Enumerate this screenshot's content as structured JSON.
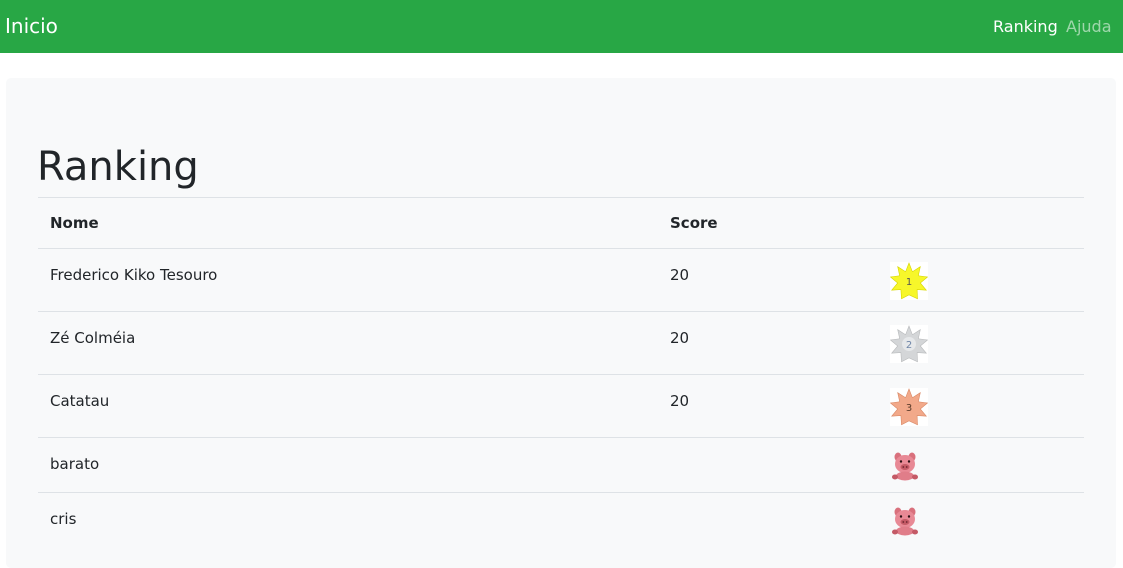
{
  "navbar": {
    "brand": "Inicio",
    "links": [
      {
        "label": "Ranking",
        "active": true
      },
      {
        "label": "Ajuda",
        "active": false
      }
    ],
    "background_color": "#28a745"
  },
  "main": {
    "title": "Ranking",
    "table": {
      "headers": [
        "Nome",
        "Score",
        ""
      ],
      "rows": [
        {
          "name": "Frederico Kiko Tesouro",
          "score": "20",
          "icon": "gold-medal-icon",
          "icon_text": "1"
        },
        {
          "name": "Zé Colméia",
          "score": "20",
          "icon": "silver-medal-icon",
          "icon_text": "2"
        },
        {
          "name": "Catatau",
          "score": "20",
          "icon": "bronze-medal-icon",
          "icon_text": "3"
        },
        {
          "name": "barato",
          "score": "",
          "icon": "pig-icon"
        },
        {
          "name": "cris",
          "score": "",
          "icon": "pig-icon"
        }
      ]
    }
  }
}
